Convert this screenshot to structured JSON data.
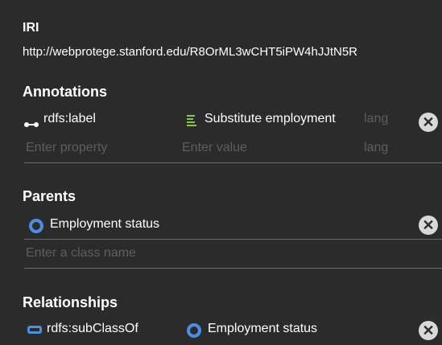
{
  "iri": {
    "heading": "IRI",
    "value": "http://webprotege.stanford.edu/R8OrML3wCHT5iPW4hJJtN5R"
  },
  "annotations": {
    "heading": "Annotations",
    "rows": [
      {
        "property": "rdfs:label",
        "value": "Substitute employment",
        "lang": "lang"
      }
    ],
    "new_row": {
      "property_placeholder": "Enter property",
      "value_placeholder": "Enter value",
      "lang_placeholder": "lang"
    }
  },
  "parents": {
    "heading": "Parents",
    "items": [
      {
        "label": "Employment status"
      }
    ],
    "input_placeholder": "Enter a class name"
  },
  "relationships": {
    "heading": "Relationships",
    "rows": [
      {
        "property": "rdfs:subClassOf",
        "value": "Employment status"
      }
    ]
  },
  "colors": {
    "background": "#2b2b2b",
    "class_icon": "#4a8fe0",
    "annotation_value_icon": "#8cc63f",
    "placeholder": "#5e5e5e",
    "remove_button": "#d8d8d8"
  },
  "icons": {
    "annotation_property": "annotation-property-icon",
    "annotation_value": "literal-value-icon",
    "class": "class-icon",
    "object_property": "object-property-icon",
    "remove": "remove-icon"
  }
}
